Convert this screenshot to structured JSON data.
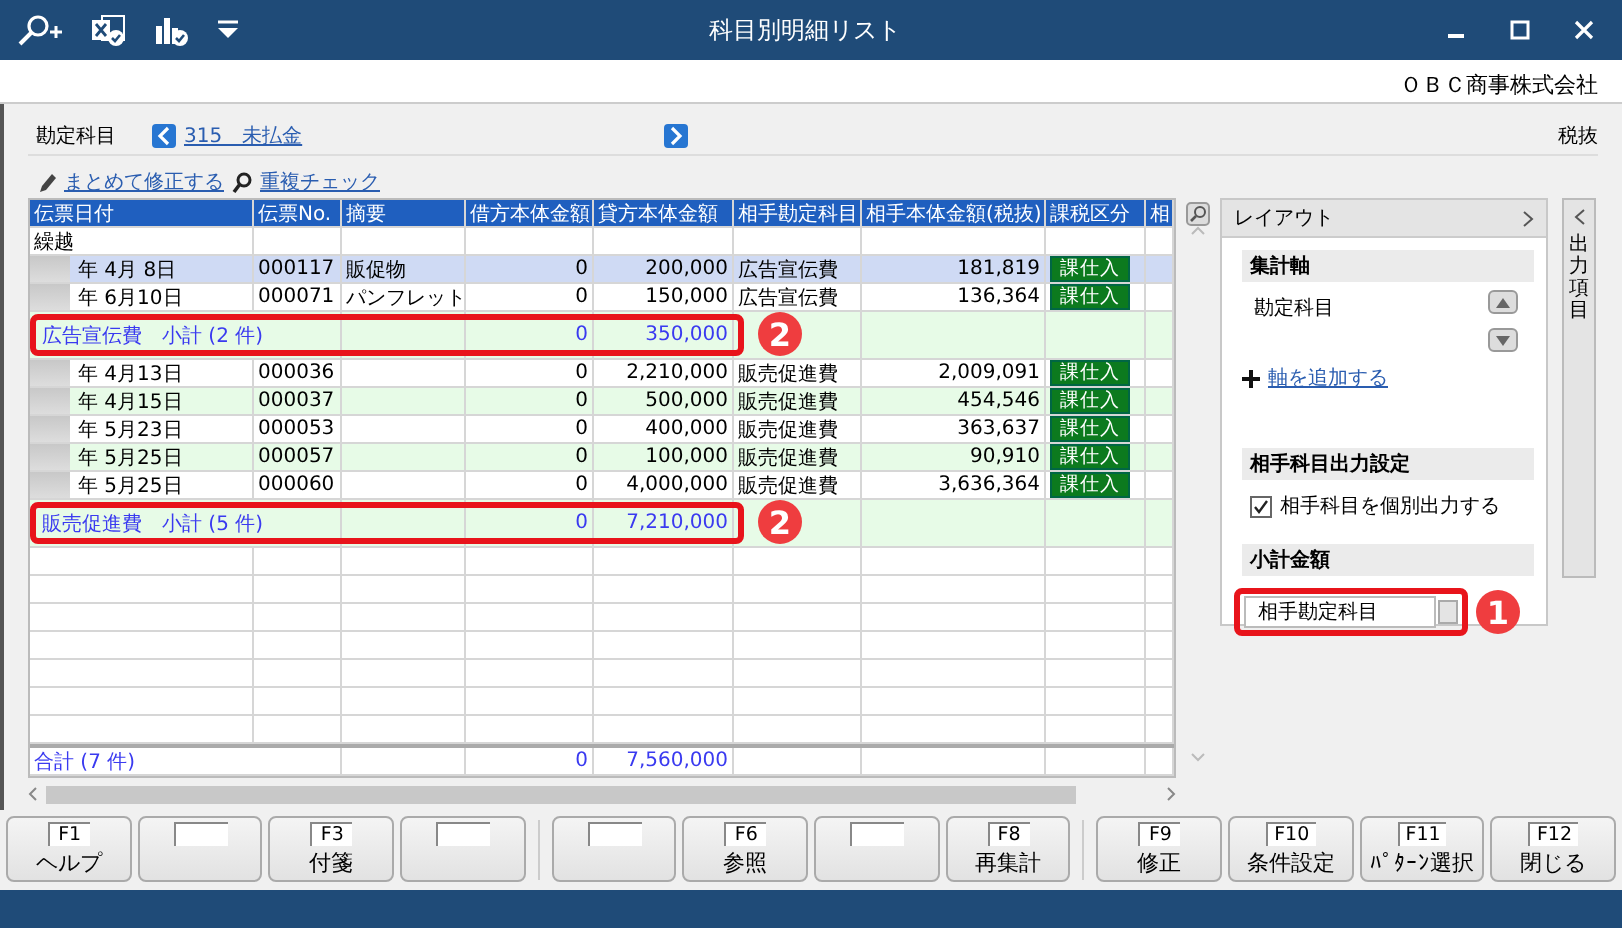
{
  "window": {
    "title": "科目別明細リスト"
  },
  "company": "ＯＢＣ商事株式会社",
  "account": {
    "label": "勘定科目",
    "value": "315　未払金"
  },
  "tax_mode": "税抜",
  "actions": [
    {
      "kind": "edit",
      "label": "まとめて修正する"
    },
    {
      "kind": "search",
      "label": "重複チェック"
    }
  ],
  "table": {
    "columns": [
      "伝票日付",
      "伝票No.",
      "摘要",
      "借方本体金額",
      "貸方本体金額",
      "相手勘定科目",
      "相手本体金額(税抜)",
      "課税区分",
      "相"
    ],
    "rows": [
      {
        "kind": "carry",
        "date": "繰越",
        "selected": false
      },
      {
        "kind": "entry",
        "date": "年 4月 8日",
        "slip_no": "000117",
        "memo": "販促物",
        "debit": "0",
        "credit": "200,000",
        "counter_account": "広告宣伝費",
        "counter_amount": "181,819",
        "tax_class": "課仕入",
        "selected": true
      },
      {
        "kind": "entry",
        "date": "年 6月10日",
        "slip_no": "000071",
        "memo": "パンフレット",
        "debit": "0",
        "credit": "150,000",
        "counter_account": "広告宣伝費",
        "counter_amount": "136,364",
        "tax_class": "課仕入",
        "selected": false
      },
      {
        "kind": "subtotal",
        "date": "広告宣伝費　小計 (2 件)",
        "debit": "0",
        "credit": "350,000",
        "callout": "2",
        "selected": false
      },
      {
        "kind": "entry",
        "date": "年 4月13日",
        "slip_no": "000036",
        "debit": "0",
        "credit": "2,210,000",
        "counter_account": "販売促進費",
        "counter_amount": "2,009,091",
        "tax_class": "課仕入",
        "selected": false
      },
      {
        "kind": "entry",
        "date": "年 4月15日",
        "slip_no": "000037",
        "debit": "0",
        "credit": "500,000",
        "counter_account": "販売促進費",
        "counter_amount": "454,546",
        "tax_class": "課仕入",
        "selected": false
      },
      {
        "kind": "entry",
        "date": "年 5月23日",
        "slip_no": "000053",
        "debit": "0",
        "credit": "400,000",
        "counter_account": "販売促進費",
        "counter_amount": "363,637",
        "tax_class": "課仕入",
        "selected": false
      },
      {
        "kind": "entry",
        "date": "年 5月25日",
        "slip_no": "000057",
        "debit": "0",
        "credit": "100,000",
        "counter_account": "販売促進費",
        "counter_amount": "90,910",
        "tax_class": "課仕入",
        "selected": false
      },
      {
        "kind": "entry",
        "date": "年 5月25日",
        "slip_no": "000060",
        "debit": "0",
        "credit": "4,000,000",
        "counter_account": "販売促進費",
        "counter_amount": "3,636,364",
        "tax_class": "課仕入",
        "selected": false
      },
      {
        "kind": "subtotal",
        "date": "販売促進費　小計 (5 件)",
        "debit": "0",
        "credit": "7,210,000",
        "callout": "2",
        "selected": false
      }
    ],
    "total": {
      "date": "合計 (7 件)",
      "debit": "0",
      "credit": "7,560,000"
    }
  },
  "panel": {
    "title": "レイアウト",
    "aggregation": {
      "heading": "集計軸",
      "axes": [
        "勘定科目"
      ],
      "add_link": "軸を追加する"
    },
    "counter_output": {
      "heading": "相手科目出力設定",
      "checkbox": {
        "label": "相手科目を個別出力する",
        "checked": true
      }
    },
    "subtotal": {
      "heading": "小計金額",
      "value": "相手勘定科目",
      "callout": "1"
    }
  },
  "side_tab": {
    "label": "出力項目"
  },
  "function_keys": [
    {
      "key": "F1",
      "label": "ヘルプ"
    },
    {
      "kind": "blank"
    },
    {
      "key": "F3",
      "label": "付箋"
    },
    {
      "kind": "blank"
    },
    {
      "kind": "blank"
    },
    {
      "key": "F6",
      "label": "参照"
    },
    {
      "kind": "blank"
    },
    {
      "key": "F8",
      "label": "再集計"
    },
    {
      "key": "F9",
      "label": "修正"
    },
    {
      "key": "F10",
      "label": "条件設定"
    },
    {
      "key": "F11",
      "label": "ﾊﾟﾀｰﾝ選択"
    },
    {
      "key": "F12",
      "label": "閉じる"
    }
  ]
}
